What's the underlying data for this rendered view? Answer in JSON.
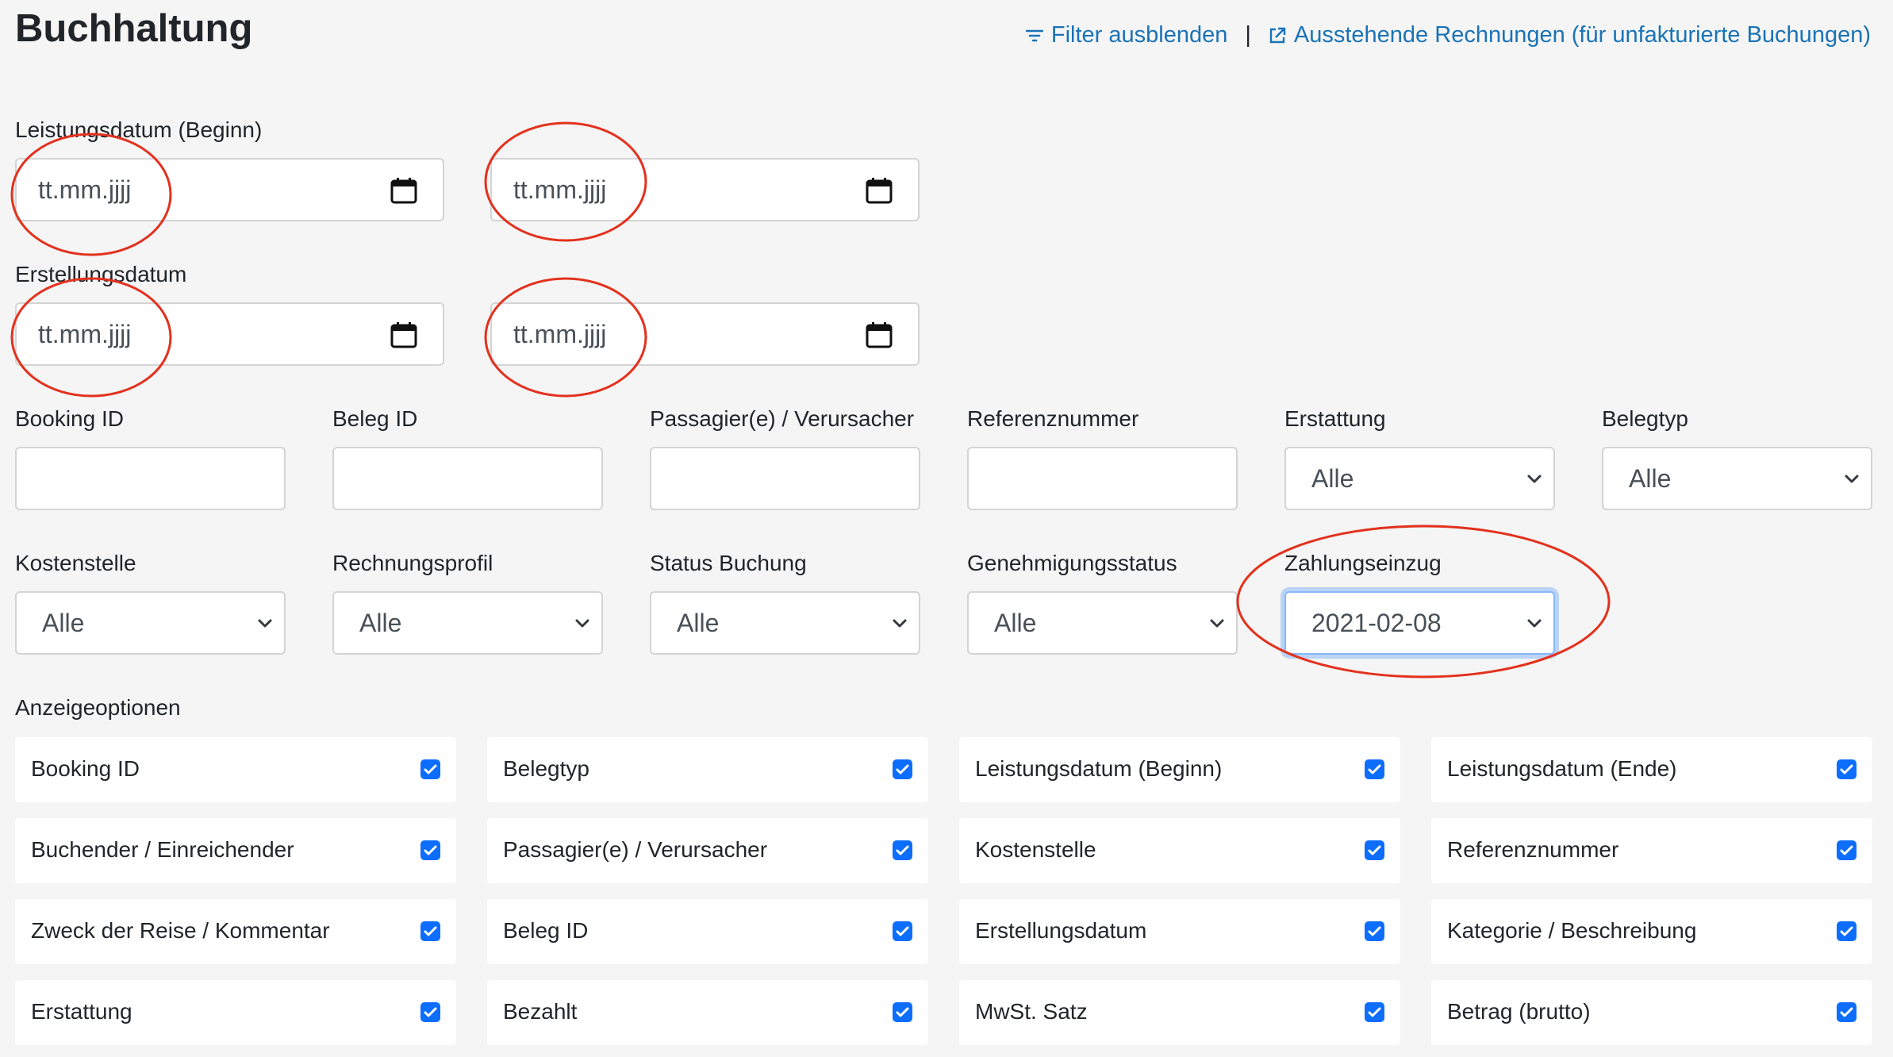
{
  "page": {
    "title": "Buchhaltung",
    "links": {
      "filter": "Filter ausblenden",
      "separator": "|",
      "invoices": "Ausstehende Rechnungen (für unfakturierte Buchungen)"
    }
  },
  "dates": {
    "leistung_label": "Leistungsdatum (Beginn)",
    "erstellung_label": "Erstellungsdatum",
    "placeholder": "tt.mm.jjjj"
  },
  "filters_row1": [
    {
      "label": "Booking ID",
      "value": ""
    },
    {
      "label": "Beleg ID",
      "value": ""
    },
    {
      "label": "Passagier(e) / Verursacher",
      "value": ""
    },
    {
      "label": "Referenznummer",
      "value": ""
    },
    {
      "label": "Erstattung",
      "value": "Alle"
    },
    {
      "label": "Belegtyp",
      "value": "Alle"
    }
  ],
  "filters_row2": [
    {
      "label": "Kostenstelle",
      "value": "Alle"
    },
    {
      "label": "Rechnungsprofil",
      "value": "Alle"
    },
    {
      "label": "Status Buchung",
      "value": "Alle"
    },
    {
      "label": "Genehmigungsstatus",
      "value": "Alle"
    },
    {
      "label": "Zahlungseinzug",
      "value": "2021-02-08"
    }
  ],
  "display": {
    "label": "Anzeigeoptionen",
    "options": [
      {
        "label": "Booking ID",
        "checked": true
      },
      {
        "label": "Belegtyp",
        "checked": true
      },
      {
        "label": "Leistungsdatum (Beginn)",
        "checked": true
      },
      {
        "label": "Leistungsdatum (Ende)",
        "checked": true
      },
      {
        "label": "Buchender / Einreichender",
        "checked": true
      },
      {
        "label": "Passagier(e) / Verursacher",
        "checked": true
      },
      {
        "label": "Kostenstelle",
        "checked": true
      },
      {
        "label": "Referenznummer",
        "checked": true
      },
      {
        "label": "Zweck der Reise / Kommentar",
        "checked": true
      },
      {
        "label": "Beleg ID",
        "checked": true
      },
      {
        "label": "Erstellungsdatum",
        "checked": true
      },
      {
        "label": "Kategorie / Beschreibung",
        "checked": true
      },
      {
        "label": "Erstattung",
        "checked": true
      },
      {
        "label": "Bezahlt",
        "checked": true
      },
      {
        "label": "MwSt. Satz",
        "checked": true
      },
      {
        "label": "Betrag (brutto)",
        "checked": true
      }
    ]
  },
  "colors": {
    "link": "#1a73b6",
    "checkbox": "#0d6efd",
    "annotation": "#e3311d"
  }
}
